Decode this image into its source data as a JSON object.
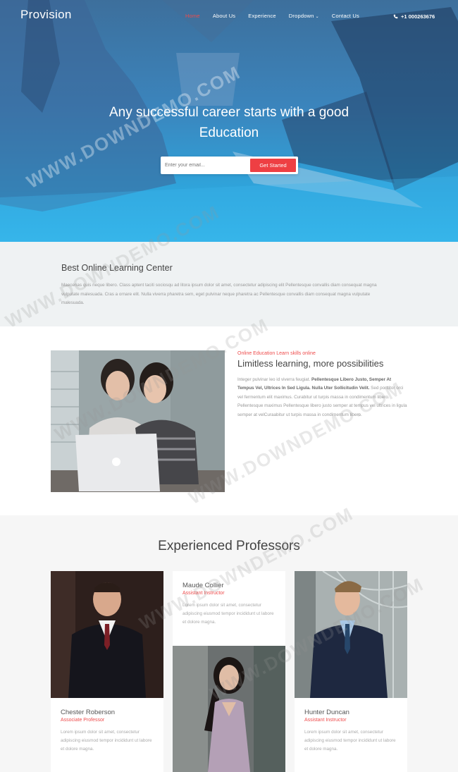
{
  "nav": {
    "brand": "Provision",
    "items": [
      {
        "label": "Home",
        "active": true
      },
      {
        "label": "About Us",
        "active": false
      },
      {
        "label": "Experience",
        "active": false
      },
      {
        "label": "Dropdown",
        "active": false,
        "caret": "⌄"
      },
      {
        "label": "Contact Us",
        "active": false
      }
    ],
    "phone": "+1 000263676"
  },
  "hero": {
    "title": "Any successful career starts with a good Education",
    "email_placeholder": "Enter your email...",
    "cta": "Get Started"
  },
  "about": {
    "title": "Best Online Learning Center",
    "text": "Maecenas quis neque libero. Class aptent taciti sociosqu ad litora ipsum dolor sit amet, consectetur adipiscing elit Pellentesque convallis diam consequat magna vulputate malesuada. Cras a ornare elit. Nulla viverra pharetra sem, eget pulvinar neque pharetra ac Pellentesque convallis diam consequat magna vulputate malesuada."
  },
  "feature": {
    "kicker": "Online Education Learn skills online",
    "title": "Limitless learning, more possibilities",
    "text_intro": "Integer pulvinar leo id viverra feugiat. ",
    "text_bold": "Pellentesque Libero Justo, Semper At Tempus Vel, Ultrices In Sed Ligula. Nulla Uter Sollicitudin Velit.",
    "text_rest": " Sed porttitor orci vel fermentum elit maximus. Curabitur ut turpis massa in condimentum libero. Pellentesque maximus Pellentesque libero justo semper at tempus vel ultrices in ligula semper at velCuraabitur ut turpis massa in condimentum libero."
  },
  "professors": {
    "title": "Experienced Professors",
    "items": [
      {
        "name": "Chester Roberson",
        "role": "Associate Professor",
        "text": "Lorem ipsum dolor sit amet, consectetur adipiscing eiusmod tempor incididunt ut labore et dolore magna."
      },
      {
        "name": "Maude Collier",
        "role": "Assistant Instructor",
        "text": "Lorem ipsum dolor sit amet, consectetur adipiscing eiusmod tempor incididunt ut labore et dolore magna."
      },
      {
        "name": "Hunter Duncan",
        "role": "Assistant Instructor",
        "text": "Lorem ipsum dolor sit amet, consectetur adipiscing eiusmod tempor incididunt ut labore et dolore magna."
      }
    ]
  },
  "watermark": "WWW.DOWNDEMO.COM",
  "colors": {
    "accent": "#ee3f43",
    "hero_top": "#3d6f9c",
    "hero_bottom": "#33b6ea"
  }
}
